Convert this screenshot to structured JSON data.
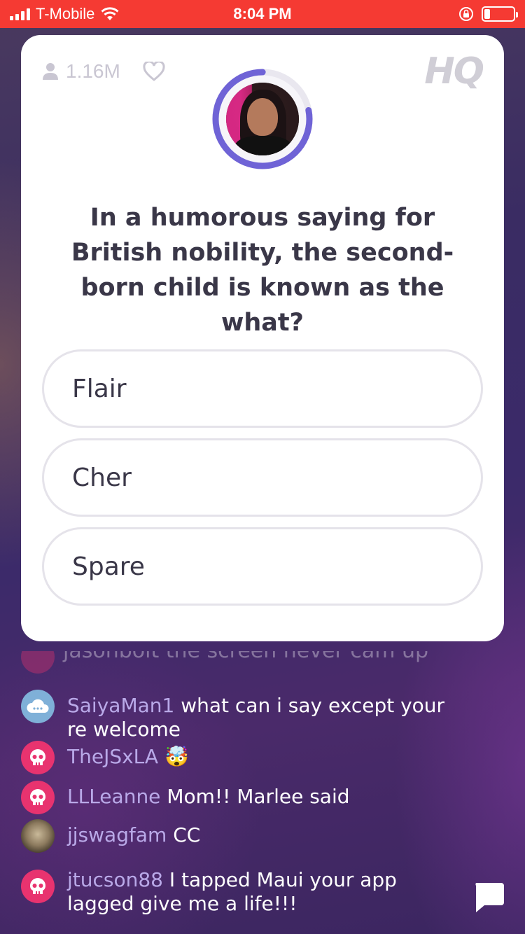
{
  "status_bar": {
    "carrier": "T-Mobile",
    "time": "8:04 PM",
    "battery_level": 0.2
  },
  "card": {
    "viewer_count": "1.16M",
    "logo": "HQ",
    "question": "In a humorous saying for British nobility, the second-born child is known as the what?",
    "answers": [
      {
        "label": "Flair"
      },
      {
        "label": "Cher"
      },
      {
        "label": "Spare"
      }
    ],
    "timer_progress": 0.78
  },
  "chat": {
    "faded_message": "jasonbolt the screen never cam up",
    "messages": [
      {
        "user": "SaiyaMan1",
        "text": "what can i say except your re welcome",
        "avatar": "cloud"
      },
      {
        "user": "TheJSxLA",
        "text": "🤯",
        "avatar": "skull"
      },
      {
        "user": "LLLeanne",
        "text": "Mom!! Marlee said",
        "avatar": "skull"
      },
      {
        "user": "jjswagfam",
        "text": "CC",
        "avatar": "photo"
      },
      {
        "user": "jtucson88",
        "text": "I tapped Maui your app lagged give me a life!!!",
        "avatar": "skull"
      }
    ]
  },
  "colors": {
    "status_bar": "#f53a33",
    "timer_ring": "#6f63d6",
    "username": "#b9a9e8",
    "avatar_pink": "#e8336f"
  }
}
